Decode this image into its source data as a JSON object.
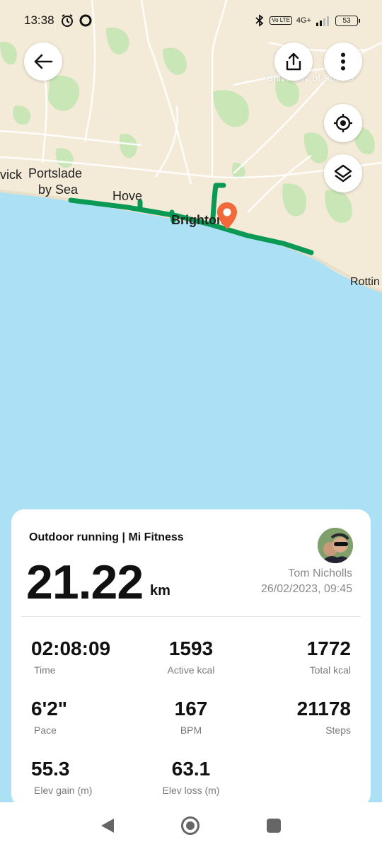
{
  "status_bar": {
    "time": "13:38",
    "network": "4G+",
    "volte": "Vo LTE",
    "battery": "53"
  },
  "map": {
    "labels": {
      "vick": "vick",
      "portslade": "Portslade",
      "by_sea": "by Sea",
      "hove": "Hove",
      "brighton": "Brighton",
      "rottin": "Rottin",
      "university": "University of Sussex"
    },
    "route_color": "#0a9a55",
    "pin_color": "#f26a3c"
  },
  "toolbar": {
    "back_icon": "arrow-left-icon",
    "share_icon": "share-icon",
    "more_icon": "more-vertical-icon",
    "locate_icon": "locate-icon",
    "layers_icon": "layers-icon"
  },
  "workout": {
    "title": "Outdoor running | Mi Fitness",
    "distance": "21.22",
    "distance_unit": "km",
    "user_name": "Tom Nicholls",
    "datetime": "26/02/2023, 09:45",
    "stats": [
      {
        "value": "02:08:09",
        "label": "Time"
      },
      {
        "value": "1593",
        "label": "Active kcal"
      },
      {
        "value": "1772",
        "label": "Total kcal"
      },
      {
        "value": "6'2\"",
        "label": "Pace"
      },
      {
        "value": "167",
        "label": "BPM"
      },
      {
        "value": "21178",
        "label": "Steps"
      },
      {
        "value": "55.3",
        "label": "Elev gain (m)"
      },
      {
        "value": "63.1",
        "label": "Elev loss (m)"
      }
    ]
  }
}
